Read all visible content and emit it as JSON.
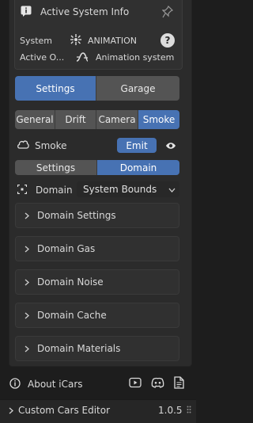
{
  "info_panel": {
    "title": "Active System Info",
    "system_label": "System",
    "system_value": "ANIMATION",
    "active_label": "Active O...",
    "active_value": "Animation system"
  },
  "main_tabs": [
    {
      "label": "Settings",
      "active": true
    },
    {
      "label": "Garage",
      "active": false
    }
  ],
  "sub_tabs": [
    {
      "label": "General",
      "active": false
    },
    {
      "label": "Drift",
      "active": false
    },
    {
      "label": "Camera",
      "active": false
    },
    {
      "label": "Smoke",
      "active": true
    }
  ],
  "smoke": {
    "label": "Smoke",
    "emit_label": "Emit"
  },
  "smoke_tabs": [
    {
      "label": "Settings",
      "active": false
    },
    {
      "label": "Domain",
      "active": true
    }
  ],
  "domain": {
    "label": "Domain",
    "select_value": "System Bounds"
  },
  "panels": [
    {
      "label": "Domain Settings"
    },
    {
      "label": "Domain Gas"
    },
    {
      "label": "Domain Noise"
    },
    {
      "label": "Domain Cache"
    },
    {
      "label": "Domain Materials"
    }
  ],
  "about": {
    "label": "About iCars"
  },
  "footer": {
    "title": "Custom Cars Editor",
    "version": "1.0.5"
  },
  "colors": {
    "accent": "#4772b3",
    "button": "#545454",
    "panel": "#303030"
  }
}
